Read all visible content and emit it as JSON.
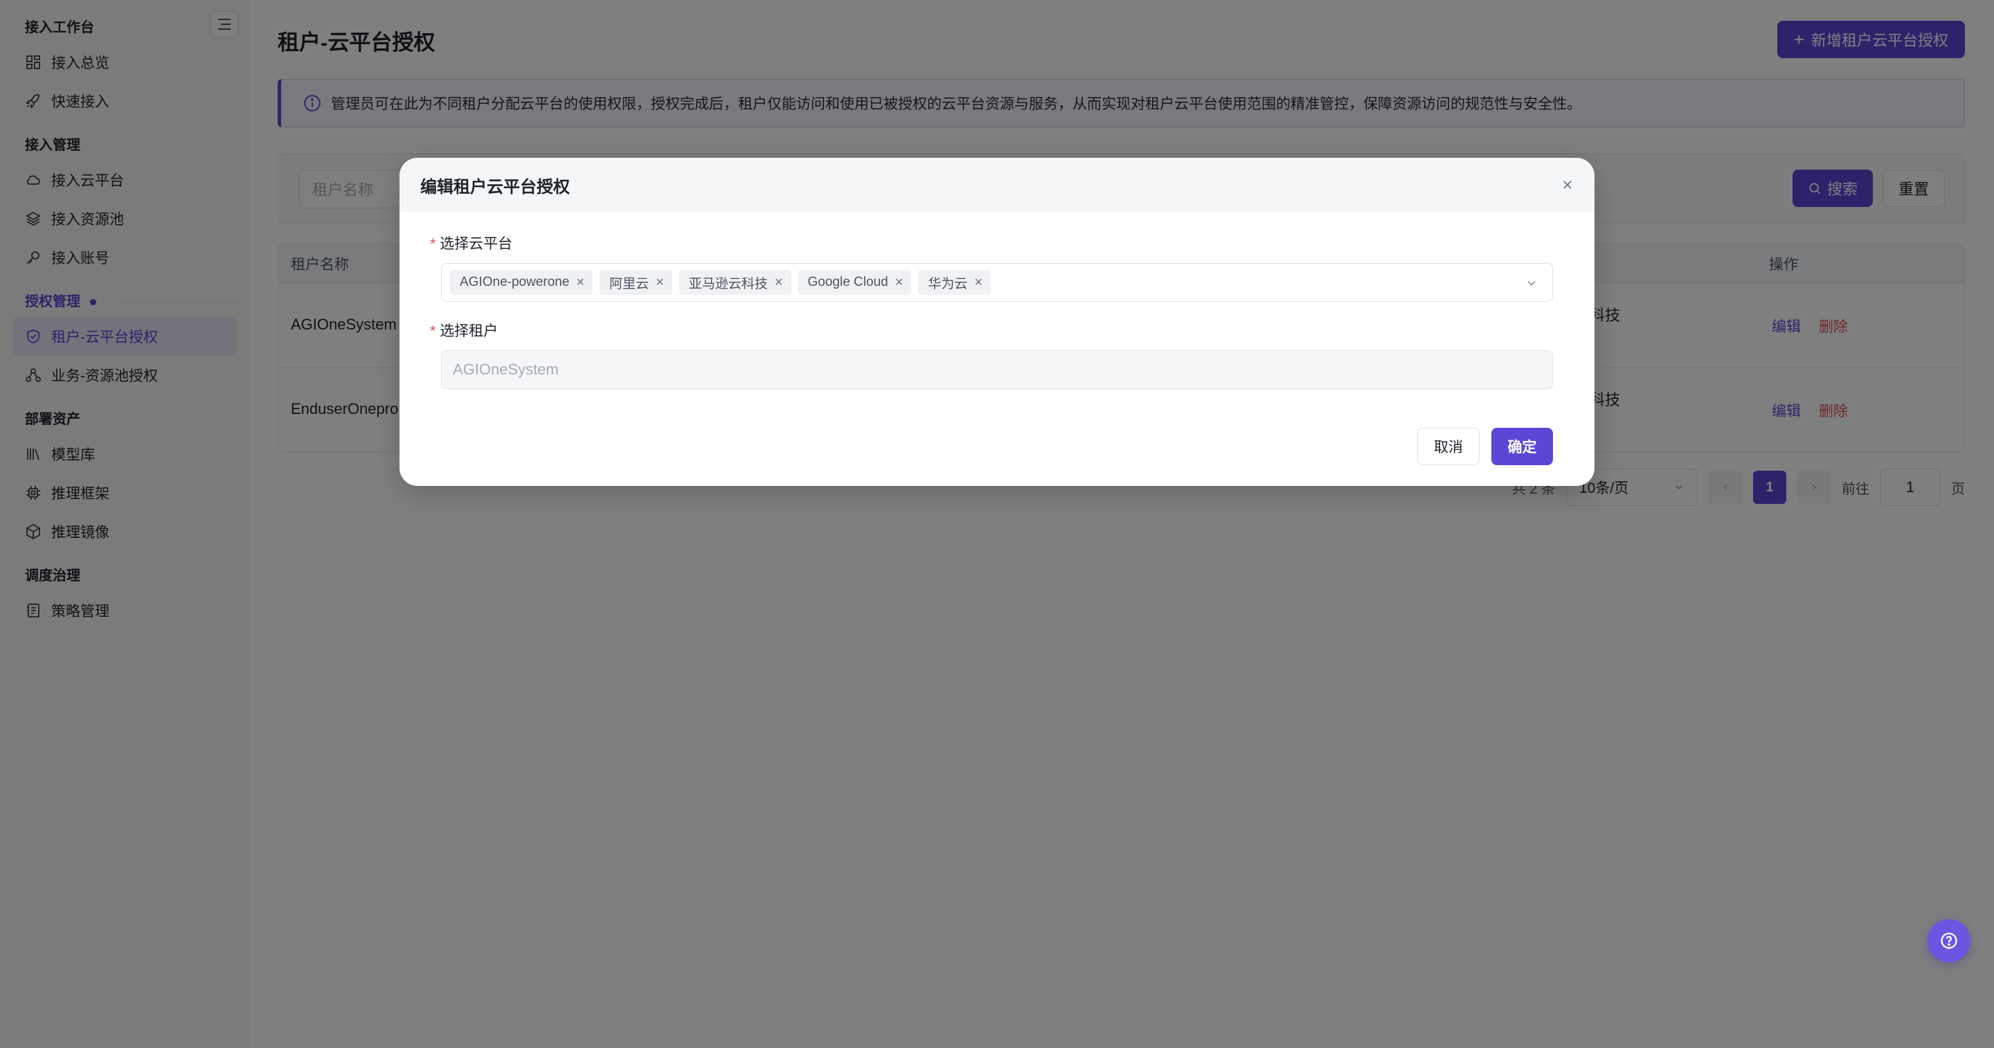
{
  "sidebar": {
    "groups": [
      {
        "title": "接入工作台",
        "items": [
          {
            "label": "接入总览",
            "icon": "grid-icon"
          },
          {
            "label": "快速接入",
            "icon": "rocket-icon"
          }
        ]
      },
      {
        "title": "接入管理",
        "items": [
          {
            "label": "接入云平台",
            "icon": "cloud-icon"
          },
          {
            "label": "接入资源池",
            "icon": "layers-icon"
          },
          {
            "label": "接入账号",
            "icon": "key-icon"
          }
        ]
      },
      {
        "title": "授权管理",
        "items": [
          {
            "label": "租户-云平台授权",
            "icon": "shield-icon",
            "active": true
          },
          {
            "label": "业务-资源池授权",
            "icon": "share-icon"
          }
        ]
      },
      {
        "title": "部署资产",
        "items": [
          {
            "label": "模型库",
            "icon": "library-icon"
          },
          {
            "label": "推理框架",
            "icon": "chip-icon"
          },
          {
            "label": "推理镜像",
            "icon": "box-icon"
          }
        ]
      },
      {
        "title": "调度治理",
        "items": [
          {
            "label": "策略管理",
            "icon": "policy-icon"
          }
        ]
      }
    ]
  },
  "header": {
    "title": "租户-云平台授权",
    "add_button": "新增租户云平台授权"
  },
  "banner": {
    "text": "管理员可在此为不同租户分配云平台的使用权限，授权完成后，租户仅能访问和使用已被授权的云平台资源与服务，从而实现对租户云平台使用范围的精准管控，保障资源访问的规范性与安全性。"
  },
  "filter": {
    "tenant_placeholder": "租户名称",
    "search_button": "搜索",
    "reset_button": "重置"
  },
  "table": {
    "columns": {
      "name": "租户名称",
      "actions": "操作"
    },
    "rows": [
      {
        "name": "AGIOneSystem",
        "platforms": "逊云科技",
        "edit": "编辑",
        "delete": "删除"
      },
      {
        "name": "EnduserOnepro",
        "platforms": "逊云科技",
        "edit": "编辑",
        "delete": "删除"
      }
    ]
  },
  "pagination": {
    "total": "共 2 条",
    "page_size": "10条/页",
    "current_page": "1",
    "goto_label": "前往",
    "goto_value": "1",
    "page_suffix": "页"
  },
  "modal": {
    "title": "编辑租户云平台授权",
    "platform_label": "选择云平台",
    "selected_platforms": [
      "AGIOne-powerone",
      "阿里云",
      "亚马逊云科技",
      "Google Cloud",
      "华为云"
    ],
    "tenant_label": "选择租户",
    "tenant_value": "AGIOneSystem",
    "cancel_button": "取消",
    "confirm_button": "确定"
  },
  "colors": {
    "accent": "#5b47d6",
    "danger": "#e34d59"
  }
}
